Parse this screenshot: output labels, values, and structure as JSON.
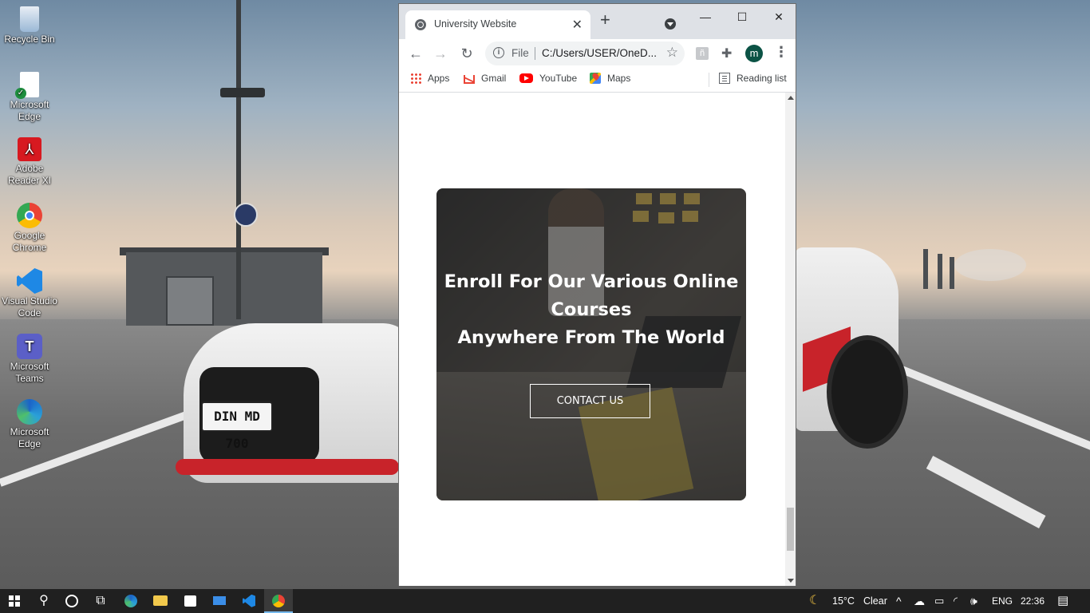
{
  "desktop": {
    "icons": [
      {
        "label": "Recycle Bin",
        "icon": "recycle-bin-icon",
        "color": "#9ab8d6"
      },
      {
        "label": "Microsoft Edge",
        "icon": "file-icon",
        "color": "#ffffff"
      },
      {
        "label": "Adobe Reader XI",
        "icon": "adobe-reader-icon",
        "color": "#d71920"
      },
      {
        "label": "Google Chrome",
        "icon": "chrome-icon",
        "color": "#4285f4"
      },
      {
        "label": "Visual Studio Code",
        "icon": "vscode-icon",
        "color": "#1e88e5"
      },
      {
        "label": "Microsoft Teams",
        "icon": "teams-icon",
        "color": "#5b5fc7"
      },
      {
        "label": "Microsoft Edge",
        "icon": "edge-icon",
        "color": "#2aa0d8"
      }
    ],
    "car_plate": "DIN MD 700"
  },
  "browser": {
    "tab_title": "University Website",
    "new_tab": "+",
    "window_controls": {
      "minimize": "—",
      "maximize": "☐",
      "close": "✕"
    },
    "toolbar": {
      "back": "←",
      "forward": "→",
      "reload": "↻",
      "menu": "⋮"
    },
    "omnibox": {
      "info": "i",
      "scheme": "File",
      "url": "C:/Users/USER/OneD...",
      "star": "☆"
    },
    "profile_initial": "m",
    "bookmarks": [
      {
        "label": "Apps",
        "icon": "apps-icon"
      },
      {
        "label": "Gmail",
        "icon": "gmail-icon"
      },
      {
        "label": "YouTube",
        "icon": "youtube-icon"
      },
      {
        "label": "Maps",
        "icon": "maps-icon"
      }
    ],
    "reading_list": "Reading list"
  },
  "page": {
    "hero_line1": "Enroll For Our Various Online",
    "hero_line2": "Courses",
    "hero_line3": "Anywhere From The World",
    "cta": "CONTACT US"
  },
  "taskbar": {
    "weather_temp": "15°C",
    "weather_text": "Clear",
    "language": "ENG",
    "time": "22:36",
    "accent": "#76b9ed"
  }
}
